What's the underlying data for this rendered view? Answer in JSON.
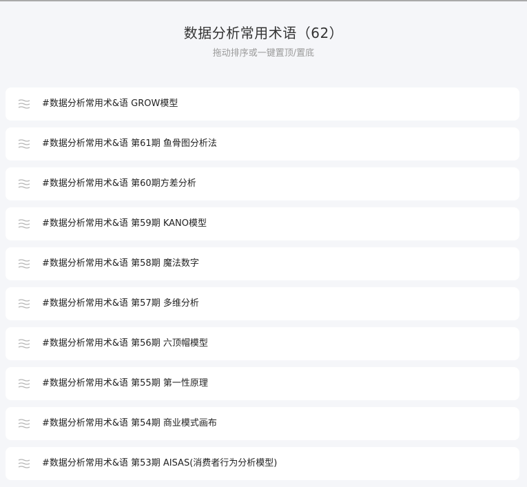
{
  "header": {
    "title": "数据分析常用术语（62）",
    "subtitle": "拖动排序或一键置顶/置底"
  },
  "items": [
    {
      "label": "#数据分析常用术&语 GROW模型"
    },
    {
      "label": "#数据分析常用术&语 第61期 鱼骨图分析法"
    },
    {
      "label": "#数据分析常用术&语 第60期方差分析"
    },
    {
      "label": "#数据分析常用术&语 第59期 KANO模型"
    },
    {
      "label": "#数据分析常用术&语 第58期 魔法数字"
    },
    {
      "label": "#数据分析常用术&语 第57期 多维分析"
    },
    {
      "label": "#数据分析常用术&语 第56期 六顶帽模型"
    },
    {
      "label": "#数据分析常用术&语 第55期 第一性原理"
    },
    {
      "label": "#数据分析常用术&语 第54期 商业模式画布"
    },
    {
      "label": "#数据分析常用术&语 第53期 AISAS(消费者行为分析模型)"
    }
  ],
  "icons": {
    "drag_handle": "drag-handle-icon"
  },
  "colors": {
    "background": "#f5f6f9",
    "card": "#ffffff",
    "title": "#333333",
    "subtitle": "#9a9a9a",
    "handle": "#b5b5b5"
  }
}
